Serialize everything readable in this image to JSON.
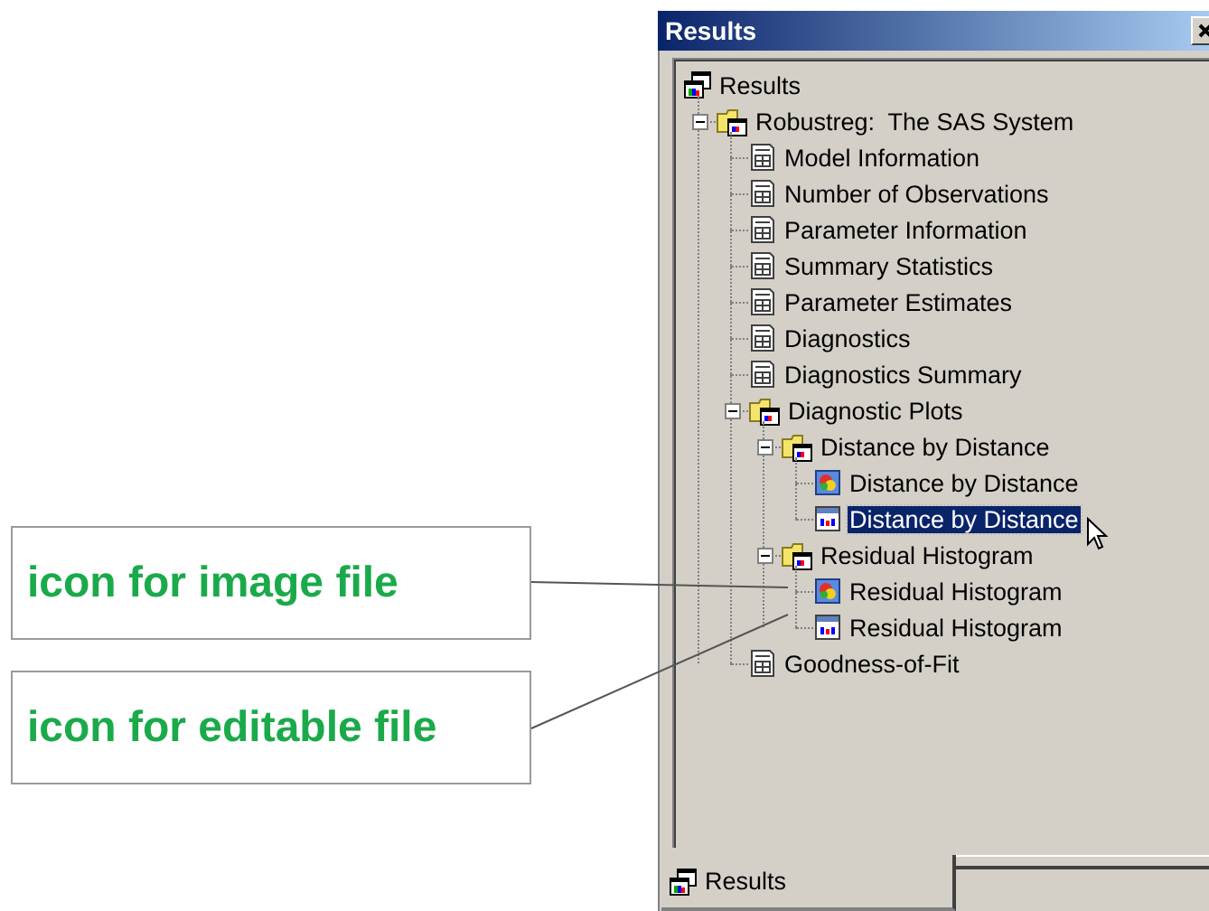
{
  "callouts": [
    {
      "text": "icon for image file"
    },
    {
      "text": "icon for editable file"
    }
  ],
  "window": {
    "title": "Results"
  },
  "tree": {
    "label": "Results",
    "kind": "results",
    "selected": false,
    "children": [
      {
        "label": "Robustreg:  The SAS System",
        "kind": "folder",
        "expanded": true,
        "selected": false,
        "children": [
          {
            "label": "Model Information",
            "kind": "table",
            "selected": false
          },
          {
            "label": "Number of Observations",
            "kind": "table",
            "selected": false
          },
          {
            "label": "Parameter Information",
            "kind": "table",
            "selected": false
          },
          {
            "label": "Summary Statistics",
            "kind": "table",
            "selected": false
          },
          {
            "label": "Parameter Estimates",
            "kind": "table",
            "selected": false
          },
          {
            "label": "Diagnostics",
            "kind": "table",
            "selected": false
          },
          {
            "label": "Diagnostics Summary",
            "kind": "table",
            "selected": false
          },
          {
            "label": "Diagnostic Plots",
            "kind": "folder",
            "expanded": true,
            "selected": false,
            "children": [
              {
                "label": "Distance by Distance",
                "kind": "folder",
                "expanded": true,
                "selected": false,
                "children": [
                  {
                    "label": "Distance by Distance",
                    "kind": "image",
                    "selected": false
                  },
                  {
                    "label": "Distance by Distance",
                    "kind": "editable",
                    "selected": true
                  }
                ]
              },
              {
                "label": "Residual Histogram",
                "kind": "folder",
                "expanded": true,
                "selected": false,
                "children": [
                  {
                    "label": "Residual Histogram",
                    "kind": "image",
                    "selected": false
                  },
                  {
                    "label": "Residual Histogram",
                    "kind": "editable",
                    "selected": false
                  }
                ]
              }
            ]
          },
          {
            "label": "Goodness-of-Fit",
            "kind": "table",
            "selected": false
          }
        ]
      }
    ]
  },
  "tabs": [
    {
      "label": "Results",
      "selected": true
    }
  ]
}
